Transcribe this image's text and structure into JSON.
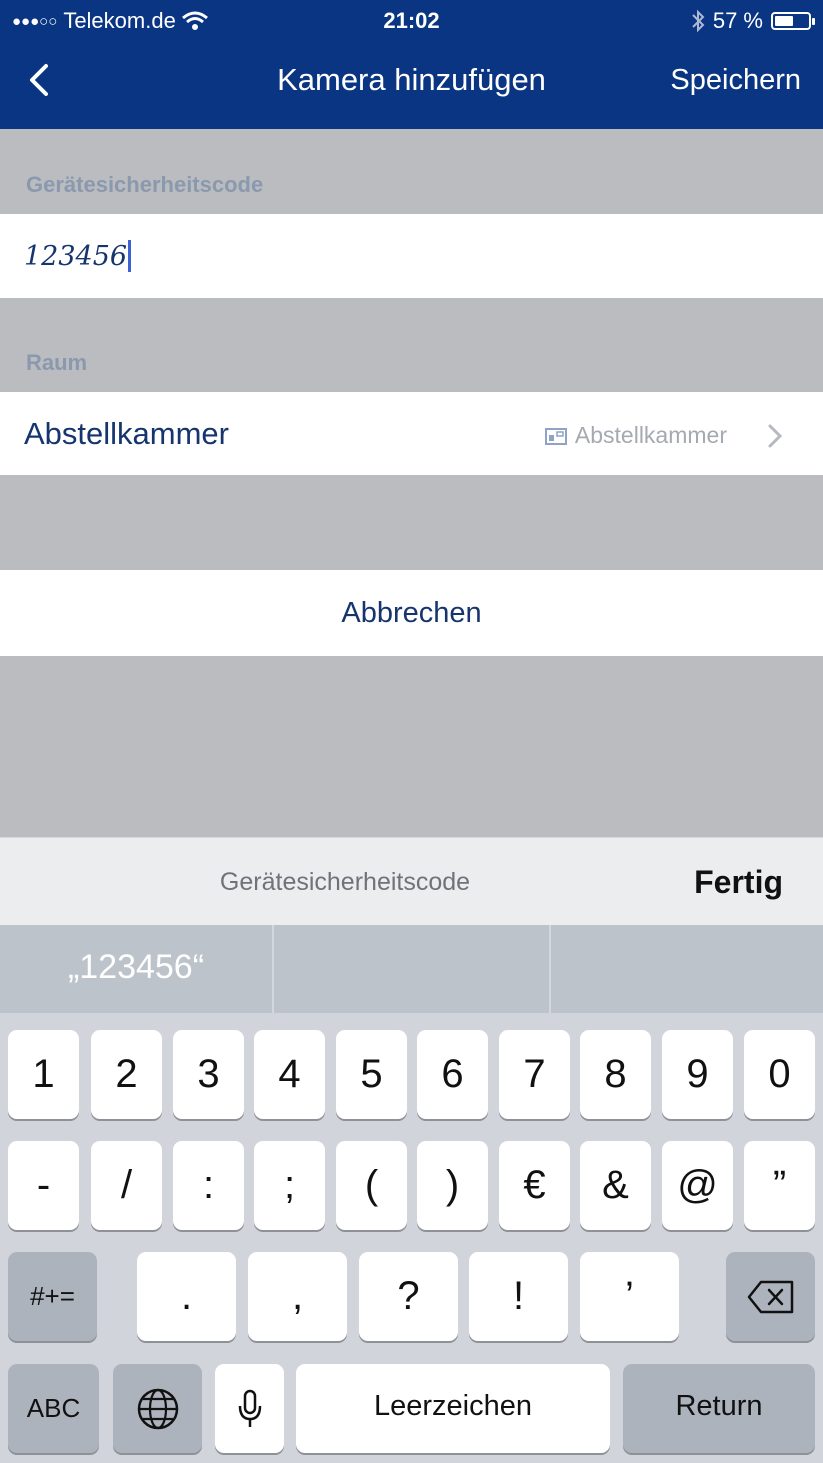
{
  "status_bar": {
    "signal_dots": "●●●○○",
    "carrier": "Telekom.de",
    "time": "21:02",
    "battery_text": "57 %",
    "battery_level": 0.57
  },
  "nav": {
    "title": "Kamera hinzufügen",
    "save_label": "Speichern",
    "back_icon": "chevron-left-icon"
  },
  "security_code": {
    "section_label": "Gerätesicherheitscode",
    "value": "123456"
  },
  "room": {
    "section_label": "Raum",
    "label": "Abstellkammer",
    "value": "Abstellkammer",
    "value_icon": "room-icon"
  },
  "cancel_label": "Abbrechen",
  "keyboard": {
    "accessory_label": "Gerätesicherheitscode",
    "done_label": "Fertig",
    "suggestions": [
      "„123456“",
      "",
      ""
    ],
    "row1": [
      "1",
      "2",
      "3",
      "4",
      "5",
      "6",
      "7",
      "8",
      "9",
      "0"
    ],
    "row2": [
      "-",
      "/",
      ":",
      ";",
      "(",
      ")",
      "€",
      "&",
      "@",
      "”"
    ],
    "row3_toggle": "#+=",
    "row3": [
      ".",
      ",",
      "?",
      "!",
      "’"
    ],
    "abc_label": "ABC",
    "space_label": "Leerzeichen",
    "return_label": "Return"
  },
  "colors": {
    "header_bg": "#0a3583",
    "text_blue": "#16356e",
    "section_label": "#8a99ad",
    "caret": "#3c63d6"
  }
}
